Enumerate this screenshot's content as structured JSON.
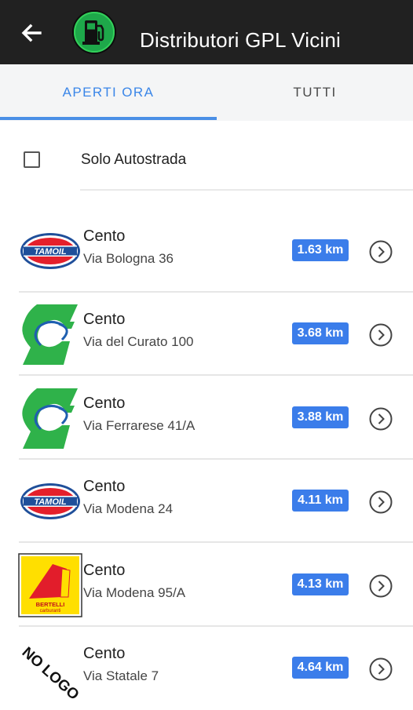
{
  "appbar": {
    "title": "Distributori GPL Vicini",
    "back_icon": "arrow-back-icon",
    "logo_icon": "fuel-pump-icon",
    "logo_color": "#2bb64a"
  },
  "tabs": [
    {
      "label": "APERTI ORA",
      "selected": true
    },
    {
      "label": "TUTTI",
      "selected": false
    }
  ],
  "filter": {
    "label": "Solo Autostrada",
    "checked": false
  },
  "stations": [
    {
      "brand": "tamoil",
      "city": "Cento",
      "street": "Via Bologna 36",
      "distance": "1.63 km"
    },
    {
      "brand": "green-road",
      "city": "Cento",
      "street": "Via del Curato 100",
      "distance": "3.68 km"
    },
    {
      "brand": "green-road",
      "city": "Cento",
      "street": "Via Ferrarese 41/A",
      "distance": "3.88 km"
    },
    {
      "brand": "tamoil",
      "city": "Cento",
      "street": "Via Modena 24",
      "distance": "4.11 km"
    },
    {
      "brand": "bertelli",
      "city": "Cento",
      "street": "Via Modena 95/A",
      "distance": "4.13 km"
    },
    {
      "brand": "no-logo",
      "city": "Cento",
      "street": "Via Statale 7",
      "distance": "4.64 km"
    }
  ],
  "brand_logos": {
    "tamoil": "TAMOIL",
    "bertelli": "BERTELLI\ncarburanti",
    "no_logo": "NO LOGO"
  },
  "colors": {
    "distance_badge": "#3b7dea",
    "tab_selected": "#3a86e8",
    "tamoil_red": "#e4202b",
    "tamoil_blue": "#1f4f9a",
    "green_brand": "#2fb24a"
  }
}
